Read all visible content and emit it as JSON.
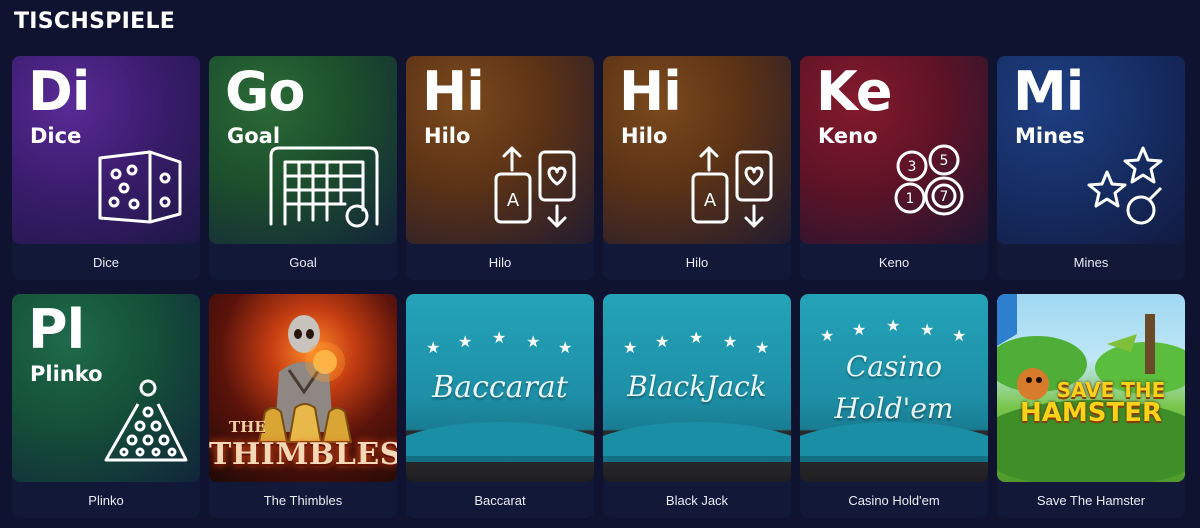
{
  "section": {
    "title": "TISCHSPIELE"
  },
  "games": [
    {
      "caption": "Dice",
      "abbr": "Di",
      "full": "Dice"
    },
    {
      "caption": "Goal",
      "abbr": "Go",
      "full": "Goal"
    },
    {
      "caption": "Hilo",
      "abbr": "Hi",
      "full": "Hilo",
      "card_letter": "A"
    },
    {
      "caption": "Hilo",
      "abbr": "Hi",
      "full": "Hilo",
      "card_letter": "A"
    },
    {
      "caption": "Keno",
      "abbr": "Ke",
      "full": "Keno",
      "balls": [
        "3",
        "5",
        "1",
        "7"
      ]
    },
    {
      "caption": "Mines",
      "abbr": "Mi",
      "full": "Mines"
    },
    {
      "caption": "Plinko",
      "abbr": "Pl",
      "full": "Plinko"
    },
    {
      "caption": "The Thimbles",
      "art_the": "THE",
      "art_title": "THIMBLES"
    },
    {
      "caption": "Baccarat",
      "art_line1": "Baccarat"
    },
    {
      "caption": "Black Jack",
      "art_line1": "BlackJack"
    },
    {
      "caption": "Casino Hold'em",
      "art_line1": "Casino",
      "art_line2": "Hold'em"
    },
    {
      "caption": "Save The Hamster",
      "art_line1": "SAVE THE",
      "art_line2": "HAMSTER"
    }
  ]
}
